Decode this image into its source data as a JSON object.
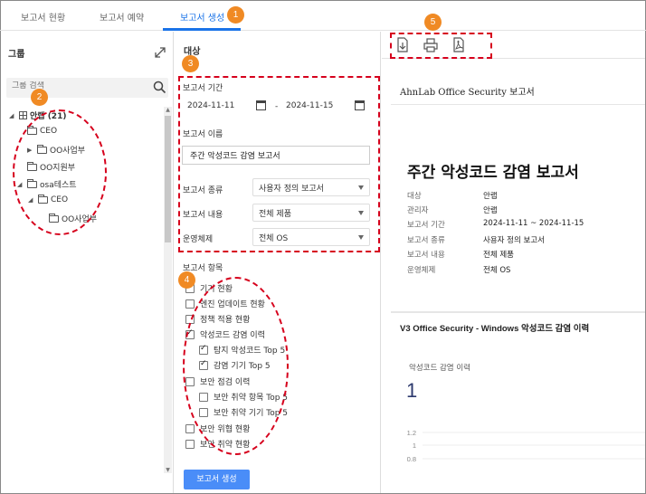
{
  "tabs": [
    {
      "label": "보고서 현황"
    },
    {
      "label": "보고서 예약"
    },
    {
      "label": "보고서 생성"
    }
  ],
  "callouts": [
    "1",
    "2",
    "3",
    "4",
    "5"
  ],
  "group_panel": {
    "title": "그룹",
    "search_placeholder": "그룹 검색",
    "tree": [
      {
        "label": "안랩 (21)",
        "icon": "grid-icon",
        "expanded": true
      },
      {
        "label": "CEO",
        "icon": "folder-icon"
      },
      {
        "label": "OO사업부",
        "icon": "folder-icon",
        "expanded": false
      },
      {
        "label": "OO지원부",
        "icon": "folder-icon"
      },
      {
        "label": "osa테스트",
        "icon": "folder-icon",
        "expanded": true
      },
      {
        "label": "CEO",
        "icon": "folder-icon",
        "expanded": true
      },
      {
        "label": "OO사업부",
        "icon": "folder-icon"
      }
    ]
  },
  "target_panel": {
    "title": "대상",
    "period_label": "보고서 기간",
    "start_date": "2024-11-11",
    "date_separator": "-",
    "end_date": "2024-11-15",
    "name_label": "보고서 이름",
    "name_value": "주간 악성코드 감염 보고서",
    "type_label": "보고서 종류",
    "type_value": "사용자 정의 보고서",
    "content_label": "보고서 내용",
    "content_value": "전체 제품",
    "os_label": "운영체제",
    "os_value": "전체 OS",
    "items_label": "보고서 항목",
    "items": [
      {
        "label": "기기 현황",
        "checked": false
      },
      {
        "label": "엔진 업데이트 현황",
        "checked": false
      },
      {
        "label": "정책 적용 현황",
        "checked": false
      },
      {
        "label": "악성코드 감염 이력",
        "checked": true
      },
      {
        "label": "탐지 악성코드 Top 5",
        "checked": true
      },
      {
        "label": "감염 기기 Top 5",
        "checked": true
      },
      {
        "label": "보안 점검 이력",
        "checked": false
      },
      {
        "label": "보안 취약 항목 Top 5",
        "checked": false
      },
      {
        "label": "보안 취약 기기 Top 5",
        "checked": false
      },
      {
        "label": "보안 위협 현황",
        "checked": false
      },
      {
        "label": "보안 취약 현황",
        "checked": false
      }
    ],
    "generate_button": "보고서 생성"
  },
  "preview": {
    "toolbar_icons": [
      "download-icon",
      "print-icon",
      "pdf-icon"
    ],
    "header": "AhnLab Office Security 보고서",
    "title": "주간 악성코드 감염 보고서",
    "meta": [
      {
        "key": "대상",
        "value": "안랩"
      },
      {
        "key": "관리자",
        "value": "안랩"
      },
      {
        "key": "보고서 기간",
        "value": "2024-11-11 ~ 2024-11-15"
      },
      {
        "key": "보고서 종류",
        "value": "사용자 정의 보고서"
      },
      {
        "key": "보고서 내용",
        "value": "전체 제품"
      },
      {
        "key": "운영체제",
        "value": "전체 OS"
      }
    ],
    "section_title": "V3 Office Security - Windows 악성코드 감염 이력",
    "chart_label": "악성코드 감염 이력",
    "chart_total": "1",
    "y_ticks": [
      "1.2",
      "1",
      "0.8"
    ]
  },
  "colors": {
    "accent": "#1a73e8",
    "button": "#4a8df8",
    "callout": "#f08a24",
    "annotation": "#d6001c"
  }
}
